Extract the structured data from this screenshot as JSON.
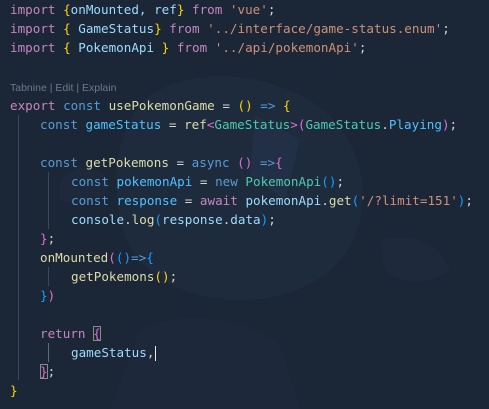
{
  "codelens": {
    "tabnine": "Tabnine",
    "sep": " | ",
    "edit": "Edit",
    "explain": "Explain"
  },
  "code": {
    "l1": {
      "import": "import",
      "open": " {",
      "names": "onMounted, ref",
      "close": "} ",
      "from": "from",
      "src": " 'vue'",
      "end": ";"
    },
    "l2": {
      "import": "import",
      "open": " { ",
      "name": "GameStatus",
      "close": "} ",
      "from": "from",
      "src": " '../interface/game-status.enum'",
      "end": ";"
    },
    "l3": {
      "import": "import",
      "open": " { ",
      "name": "PokemonApi",
      "close": " } ",
      "from": "from",
      "src": " '../api/pokemonApi'",
      "end": ";"
    },
    "l4": {
      "export": "export",
      "const": " const ",
      "name": "usePokemonGame",
      "eq": " = ",
      "po": "(",
      "pc": ")",
      "arrow": " => ",
      "brace": "{"
    },
    "l5": {
      "const": "const ",
      "name": "gameStatus",
      "eq": " = ",
      "fn": "ref",
      "lt": "<",
      "type": "GameStatus",
      "gt": ">",
      "po": "(",
      "obj": "GameStatus",
      "dot": ".",
      "prop": "Playing",
      "pc": ")",
      "end": ";"
    },
    "l6": {
      "const": "const ",
      "name": "getPokemons",
      "eq": " = ",
      "async": "async",
      "sp": " ",
      "po": "(",
      "pc": ")",
      "arrow": " =>",
      "brace": "{"
    },
    "l7": {
      "const": "const ",
      "name": "pokemonApi",
      "eq": " = ",
      "new": "new",
      "sp": " ",
      "cls": "PokemonApi",
      "po": "(",
      "pc": ")",
      "end": ";"
    },
    "l8": {
      "const": "const ",
      "name": "response",
      "eq": " = ",
      "await": "await",
      "sp": " ",
      "obj": "pokemonApi",
      "dot": ".",
      "fn": "get",
      "po": "(",
      "str": "'/?limit=151'",
      "pc": ")",
      "end": ";"
    },
    "l9": {
      "obj": "console",
      "dot": ".",
      "fn": "log",
      "po": "(",
      "arg": "response",
      "dot2": ".",
      "prop": "data",
      "pc": ")",
      "end": ";"
    },
    "l10": {
      "brace": "}",
      "end": ";"
    },
    "l11": {
      "fn": "onMounted",
      "po": "(",
      "ipo": "(",
      "ipc": ")",
      "arrow": "=>",
      "brace": "{"
    },
    "l12": {
      "fn": "getPokemons",
      "po": "(",
      "pc": ")",
      "end": ";"
    },
    "l13": {
      "brace": "}",
      "pc": ")"
    },
    "l14": {
      "return": "return",
      "sp": " ",
      "brace": "{"
    },
    "l15": {
      "name": "gameStatus",
      "comma": ","
    },
    "l16": {
      "brace": "}",
      "end": ";"
    },
    "l17": {
      "brace": "}"
    }
  }
}
